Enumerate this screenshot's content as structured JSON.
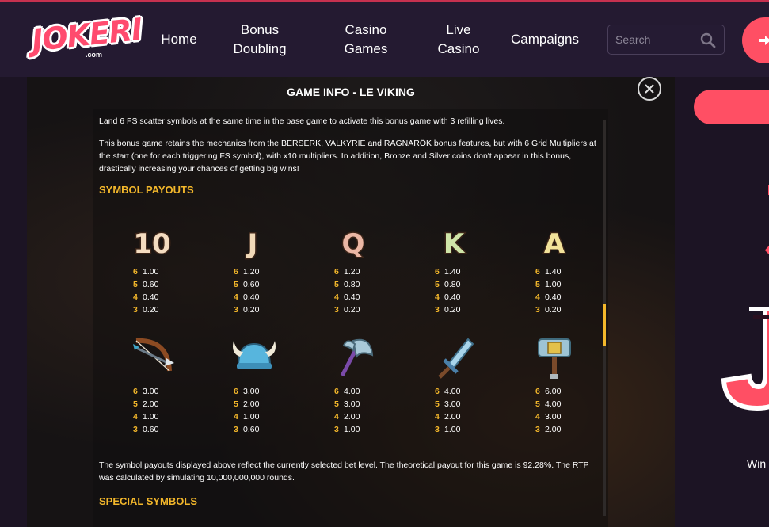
{
  "brand": {
    "name": "JOKERI",
    "domain": ".com",
    "accent": "#ff4f64",
    "gold": "#f3b72b"
  },
  "nav": {
    "items": [
      {
        "line1": "Home",
        "line2": ""
      },
      {
        "line1": "Bonus",
        "line2": "Doubling"
      },
      {
        "line1": "Casino",
        "line2": "Games"
      },
      {
        "line1": "Live",
        "line2": "Casino"
      },
      {
        "line1": "Campaigns",
        "line2": ""
      }
    ],
    "search": {
      "placeholder": "Search",
      "icon": "search-icon"
    },
    "login_icon": "login-arrow-icon"
  },
  "background": {
    "win_text": "Win"
  },
  "modal": {
    "title": "GAME INFO - LE VIKING",
    "close_icon": "close-icon",
    "intro_1": "Land 6 FS scatter symbols at the same time in the base game to activate this bonus game with 3 refilling lives.",
    "intro_2": "This bonus game retains the mechanics from the BERSERK, VALKYRIE and RAGNARÖK bonus features, but with 6 Grid Multipliers at the start (one for each triggering FS symbol), with x10 multipliers. In addition, Bronze and Silver coins don't appear in this bonus, drastically increasing your chances of getting big wins!",
    "symbol_payouts_heading": "SYMBOL PAYOUTS",
    "symbols_row1": [
      {
        "label": "10",
        "icon": "ten-symbol-icon",
        "payouts": [
          {
            "count": "6",
            "value": "1.00"
          },
          {
            "count": "5",
            "value": "0.60"
          },
          {
            "count": "4",
            "value": "0.40"
          },
          {
            "count": "3",
            "value": "0.20"
          }
        ]
      },
      {
        "label": "J",
        "icon": "jack-symbol-icon",
        "payouts": [
          {
            "count": "6",
            "value": "1.20"
          },
          {
            "count": "5",
            "value": "0.60"
          },
          {
            "count": "4",
            "value": "0.40"
          },
          {
            "count": "3",
            "value": "0.20"
          }
        ]
      },
      {
        "label": "Q",
        "icon": "queen-symbol-icon",
        "payouts": [
          {
            "count": "6",
            "value": "1.20"
          },
          {
            "count": "5",
            "value": "0.80"
          },
          {
            "count": "4",
            "value": "0.40"
          },
          {
            "count": "3",
            "value": "0.20"
          }
        ]
      },
      {
        "label": "K",
        "icon": "king-symbol-icon",
        "payouts": [
          {
            "count": "6",
            "value": "1.40"
          },
          {
            "count": "5",
            "value": "0.80"
          },
          {
            "count": "4",
            "value": "0.40"
          },
          {
            "count": "3",
            "value": "0.20"
          }
        ]
      },
      {
        "label": "A",
        "icon": "ace-symbol-icon",
        "payouts": [
          {
            "count": "6",
            "value": "1.40"
          },
          {
            "count": "5",
            "value": "1.00"
          },
          {
            "count": "4",
            "value": "0.40"
          },
          {
            "count": "3",
            "value": "0.20"
          }
        ]
      }
    ],
    "symbols_row2": [
      {
        "icon": "bow-symbol-icon",
        "payouts": [
          {
            "count": "6",
            "value": "3.00"
          },
          {
            "count": "5",
            "value": "2.00"
          },
          {
            "count": "4",
            "value": "1.00"
          },
          {
            "count": "3",
            "value": "0.60"
          }
        ]
      },
      {
        "icon": "viking-helmet-symbol-icon",
        "payouts": [
          {
            "count": "6",
            "value": "3.00"
          },
          {
            "count": "5",
            "value": "2.00"
          },
          {
            "count": "4",
            "value": "1.00"
          },
          {
            "count": "3",
            "value": "0.60"
          }
        ]
      },
      {
        "icon": "axe-symbol-icon",
        "payouts": [
          {
            "count": "6",
            "value": "4.00"
          },
          {
            "count": "5",
            "value": "3.00"
          },
          {
            "count": "4",
            "value": "2.00"
          },
          {
            "count": "3",
            "value": "1.00"
          }
        ]
      },
      {
        "icon": "sword-symbol-icon",
        "payouts": [
          {
            "count": "6",
            "value": "4.00"
          },
          {
            "count": "5",
            "value": "3.00"
          },
          {
            "count": "4",
            "value": "2.00"
          },
          {
            "count": "3",
            "value": "1.00"
          }
        ]
      },
      {
        "icon": "hammer-symbol-icon",
        "payouts": [
          {
            "count": "6",
            "value": "6.00"
          },
          {
            "count": "5",
            "value": "4.00"
          },
          {
            "count": "4",
            "value": "3.00"
          },
          {
            "count": "3",
            "value": "2.00"
          }
        ]
      }
    ],
    "rtp_text": "The symbol payouts displayed above reflect the currently selected bet level. The theoretical payout for this game is 92.28%. The RTP was calculated by simulating 10,000,000,000 rounds.",
    "special_symbols_heading": "SPECIAL SYMBOLS"
  }
}
